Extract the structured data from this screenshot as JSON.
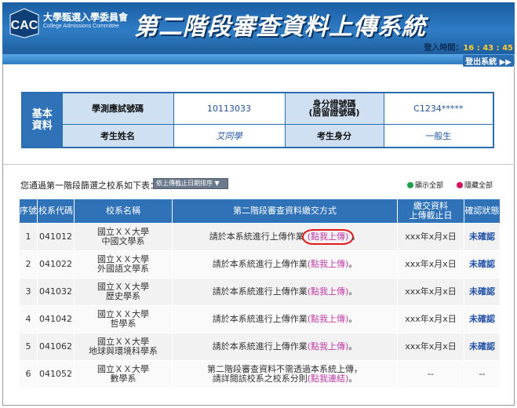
{
  "header": {
    "org_cn": "大學甄選入學委員會",
    "org_en": "College Admissions Committee",
    "logo_text": "CAC",
    "system_title": "第二階段審查資料上傳系統",
    "login_label": "登入時間：",
    "login_time": "16 : 43 : 45",
    "logout_label": "登出系統 ▶▶"
  },
  "basic_info": {
    "side_label_line1": "基本",
    "side_label_line2": "資料",
    "exam_no_label": "學測應試號碼",
    "exam_no_value": "10113033",
    "id_label_line1": "身分證號碼",
    "id_label_line2": "(居留證號碼)",
    "id_value": "C1234*****",
    "name_label": "考生姓名",
    "name_value": "艾同學",
    "status_label": "考生身分",
    "status_value": "一般生"
  },
  "list": {
    "intro": "您通過第一階段篩選之校系如下表：",
    "sort_value": "依上傳截止日期排序 ▼",
    "show_all": "顯示全部",
    "hide_all": "隱藏全部",
    "show_color": "#1aa34a",
    "hide_color": "#d4145a"
  },
  "table": {
    "headers": {
      "seq": "序號",
      "code": "校系代碼",
      "name": "校系名稱",
      "method": "第二階段審查資料繳交方式",
      "deadline_line1": "繳交資料",
      "deadline_line2": "上傳截止日",
      "status": "確認狀態"
    },
    "rows": [
      {
        "seq": "1",
        "code": "041012",
        "name1": "國立ＸＸ大學",
        "name2": "中國文學系",
        "method": "請於本系統進行上傳作業",
        "link": "(點我上傳)",
        "end": "。",
        "deadline": "xxx年x月x日",
        "status": "未確認"
      },
      {
        "seq": "2",
        "code": "041022",
        "name1": "國立ＸＸ大學",
        "name2": "外國語文學系",
        "method": "請於本系統進行上傳作業",
        "link": "(點我上傳)",
        "end": "。",
        "deadline": "xxx年x月x日",
        "status": "未確認"
      },
      {
        "seq": "3",
        "code": "041032",
        "name1": "國立ＸＸ大學",
        "name2": "歷史學系",
        "method": "請於本系統進行上傳作業",
        "link": "(點我上傳)",
        "end": "。",
        "deadline": "xxx年x月x日",
        "status": "未確認"
      },
      {
        "seq": "4",
        "code": "041042",
        "name1": "國立ＸＸ大學",
        "name2": "哲學系",
        "method": "請於本系統進行上傳作業",
        "link": "(點我上傳)",
        "end": "。",
        "deadline": "xxx年x月x日",
        "status": "未確認"
      },
      {
        "seq": "5",
        "code": "041062",
        "name1": "國立ＸＸ大學",
        "name2": "地球與環境科學系",
        "method": "請於本系統進行上傳作業",
        "link": "(點我上傳)",
        "end": "。",
        "deadline": "xxx年x月x日",
        "status": "未確認"
      },
      {
        "seq": "6",
        "code": "041052",
        "name1": "國立ＸＸ大學",
        "name2": "數學系",
        "method1": "第二階段審查資料不需透過本系統上傳，",
        "method2": "請詳閱該校系之校系分則",
        "link": "(點我連結)",
        "end": "。",
        "deadline": "--",
        "status": "--"
      }
    ]
  }
}
